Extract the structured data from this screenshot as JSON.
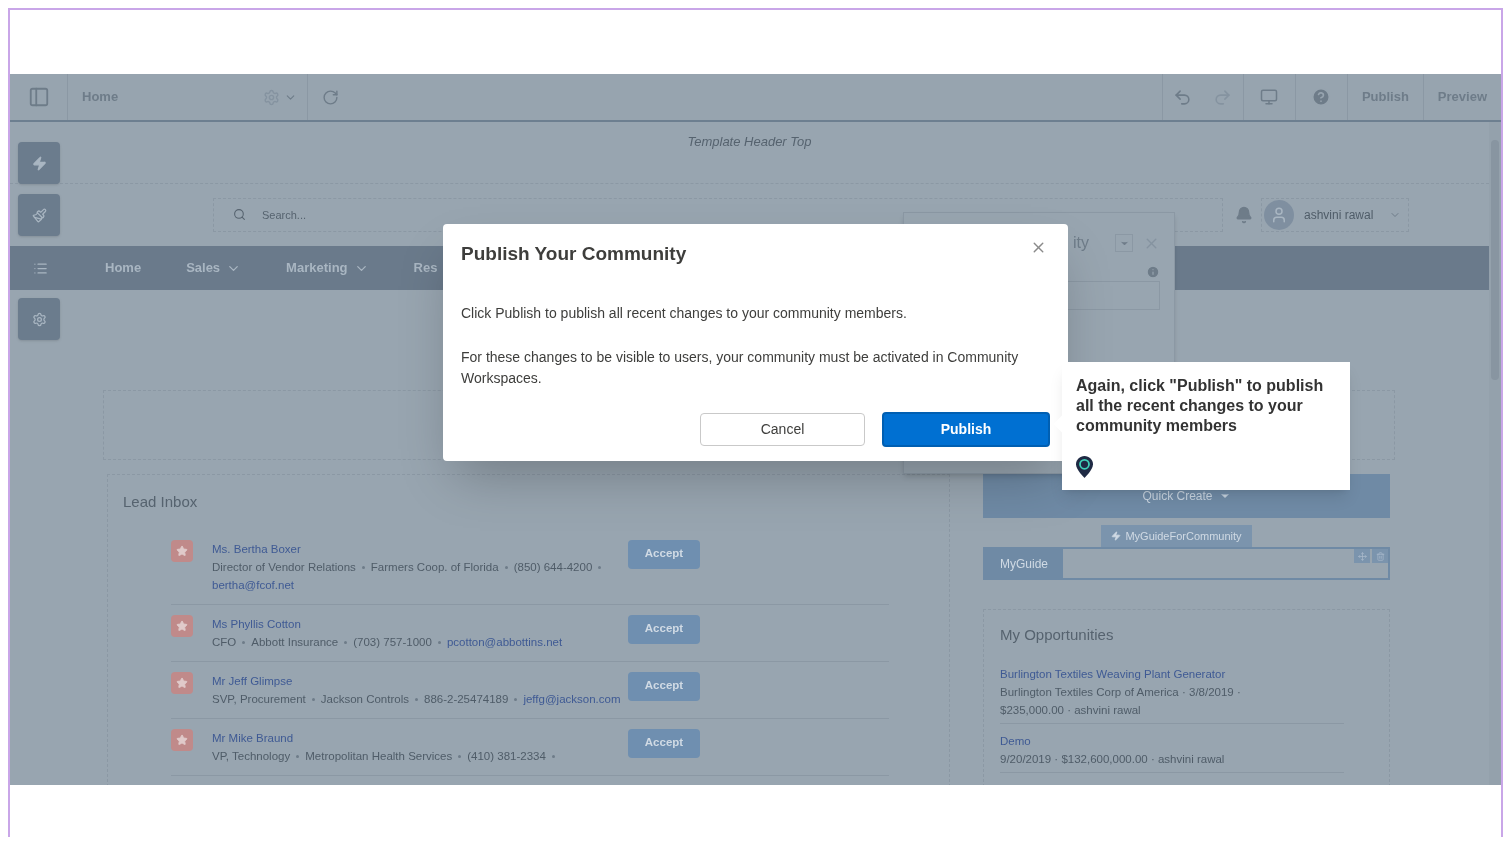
{
  "toolbar": {
    "page": "Home",
    "actions": [
      "Publish",
      "Preview"
    ]
  },
  "template_header": "Template Header Top",
  "search": {
    "placeholder": "Search..."
  },
  "user": {
    "name": "ashvini rawal"
  },
  "nav": [
    {
      "label": "Home",
      "dropdown": false
    },
    {
      "label": "Sales",
      "dropdown": true
    },
    {
      "label": "Marketing",
      "dropdown": true
    },
    {
      "label": "Res",
      "dropdown": false
    }
  ],
  "background_panel": {
    "title": "ity"
  },
  "lead_inbox": {
    "title": "Lead Inbox",
    "leads": [
      {
        "name": "Ms. Bertha Boxer",
        "details": [
          "Director of Vendor Relations",
          "Farmers Coop. of Florida",
          "(850) 644-4200"
        ],
        "email": "bertha@fcof.net",
        "action": "Accept"
      },
      {
        "name": "Ms Phyllis Cotton",
        "details": [
          "CFO",
          "Abbott Insurance",
          "(703) 757-1000"
        ],
        "email": "pcotton@abbottins.net",
        "action": "Accept"
      },
      {
        "name": "Mr Jeff Glimpse",
        "details": [
          "SVP, Procurement",
          "Jackson Controls",
          "886-2-25474189"
        ],
        "email": "jeffg@jackson.com",
        "action": "Accept"
      },
      {
        "name": "Mr Mike Braund",
        "details": [
          "VP, Technology",
          "Metropolitan Health Services",
          "(410) 381-2334"
        ],
        "action": "Accept"
      }
    ]
  },
  "quick_create": {
    "label": "Quick Create"
  },
  "component": {
    "label": "MyGuideForCommunity",
    "tab": "MyGuide"
  },
  "opportunities": {
    "title": "My Opportunities",
    "items": [
      {
        "name": "Burlington Textiles Weaving Plant Generator",
        "details": "Burlington Textiles Corp of America · 3/8/2019 · $235,000.00 · ashvini rawal"
      },
      {
        "name": "Demo",
        "details": "9/20/2019 · $132,600,000.00 · ashvini rawal"
      }
    ]
  },
  "modal": {
    "title": "Publish Your Community",
    "paragraphs": [
      "Click Publish to publish all recent changes to your community members.",
      "For these changes to be visible to users, your community must be activated in Community Workspaces."
    ],
    "cancel": "Cancel",
    "confirm": "Publish"
  },
  "tooltip": {
    "text": "Again, click \"Publish\" to publish all the recent changes to your community members"
  }
}
